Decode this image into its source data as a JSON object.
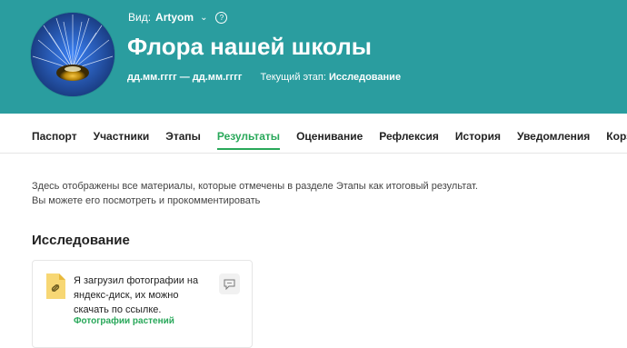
{
  "header": {
    "view_label": "Вид:",
    "view_user": "Artyom",
    "help_symbol": "?",
    "title": "Флора нашей школы",
    "dates": "дд.мм.гггг — дд.мм.гггг",
    "stage_label": "Текущий этап:",
    "stage_value": "Исследование",
    "bg_color": "#2a9d9f"
  },
  "tabs": [
    {
      "label": "Паспорт",
      "active": false
    },
    {
      "label": "Участники",
      "active": false
    },
    {
      "label": "Этапы",
      "active": false
    },
    {
      "label": "Результаты",
      "active": true
    },
    {
      "label": "Оценивание",
      "active": false
    },
    {
      "label": "Рефлексия",
      "active": false
    },
    {
      "label": "История",
      "active": false
    },
    {
      "label": "Уведомления",
      "active": false
    },
    {
      "label": "Корзина",
      "active": false
    }
  ],
  "intro": {
    "line1": "Здесь отображены все материалы, которые отмечены в разделе Этапы как итоговый результат.",
    "line2": "Вы можете его посмотреть и прокомментировать"
  },
  "section": {
    "title": "Исследование",
    "card": {
      "text": "Я загрузил фотографии на яндекс-диск, их можно скачать по ссылке.",
      "link": "Фотографии растений",
      "file_icon": "link-file-icon",
      "comment_icon": "comment-icon"
    }
  },
  "colors": {
    "accent": "#29a85a",
    "header_bg": "#2a9d9f",
    "file_icon": "#f7d774"
  }
}
